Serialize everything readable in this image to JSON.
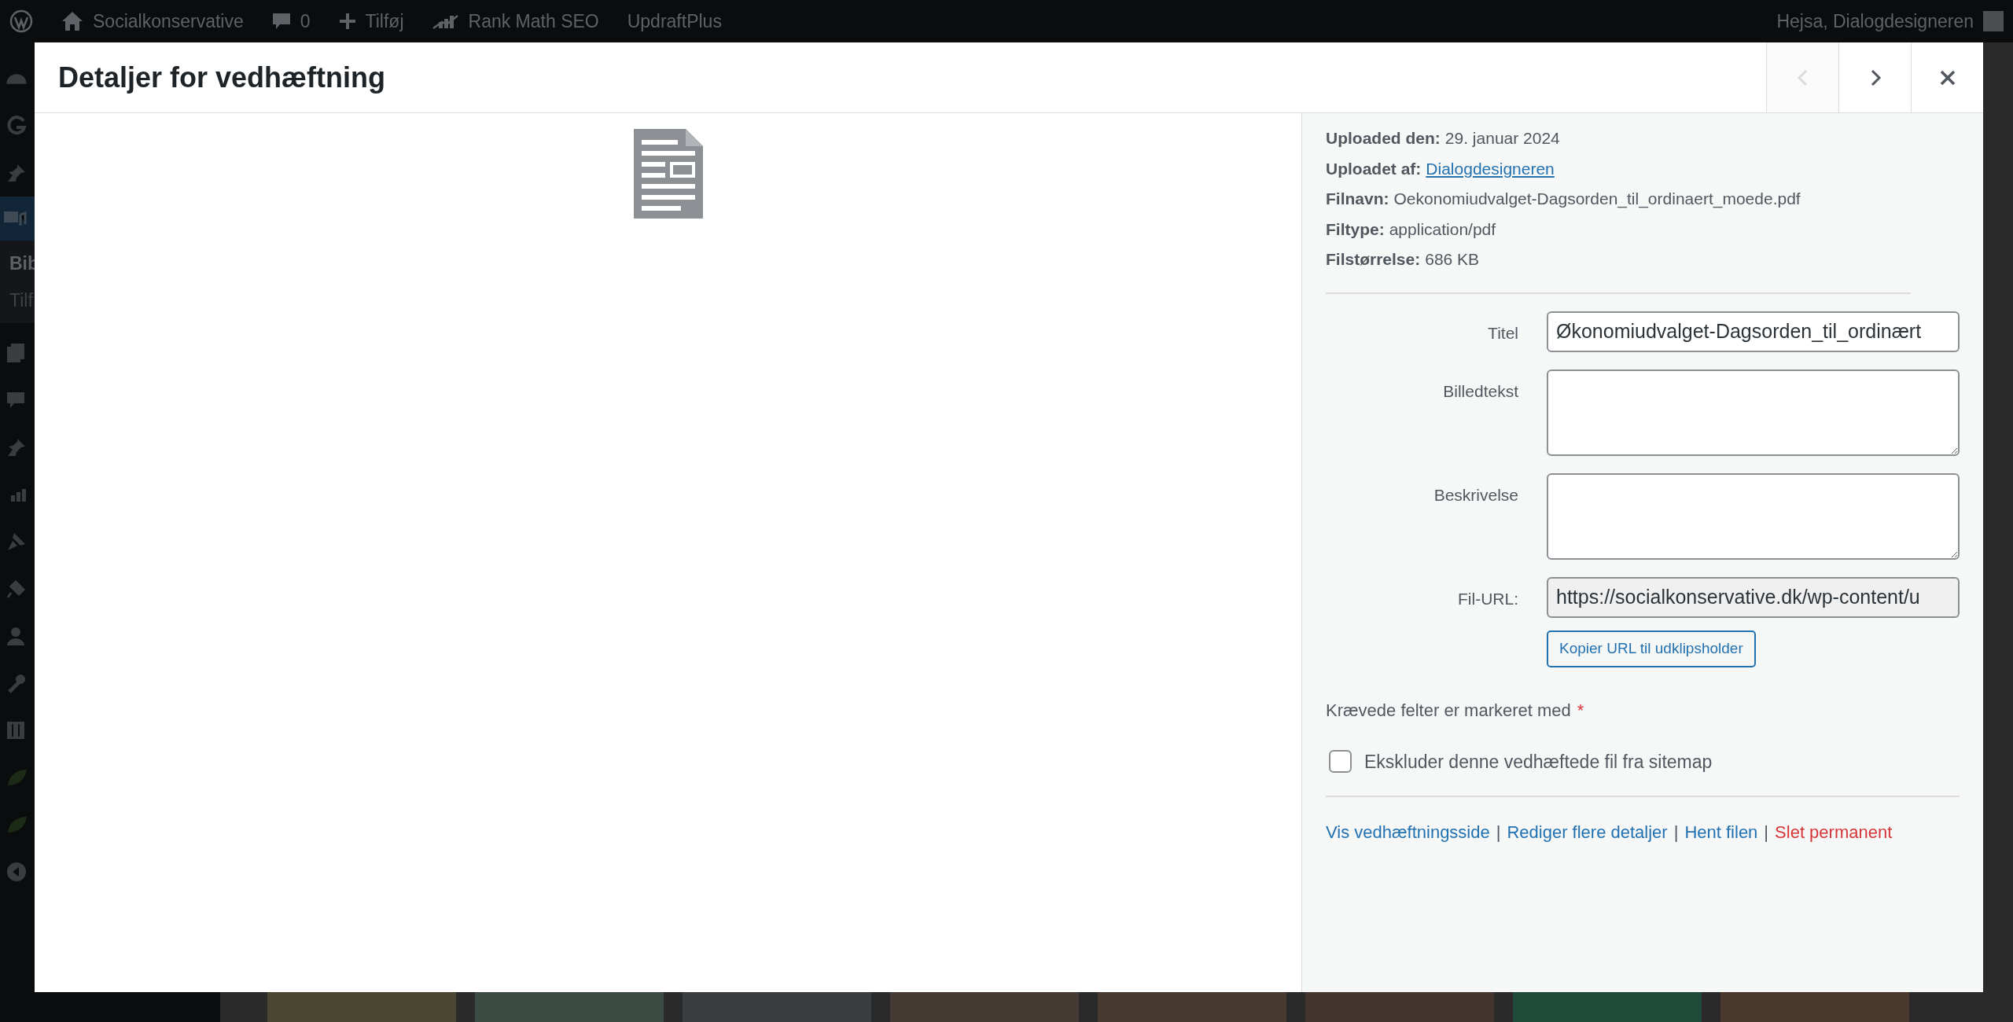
{
  "admin_bar": {
    "items": [
      {
        "kind": "logo"
      },
      {
        "kind": "home",
        "label": "Socialkonservative"
      },
      {
        "kind": "comments",
        "label": "0"
      },
      {
        "kind": "add",
        "label": "Tilføj"
      },
      {
        "kind": "rankmath",
        "label": "Rank Math SEO"
      },
      {
        "kind": "text",
        "label": "UpdraftPlus"
      }
    ],
    "greeting": "Hejsa, Dialogdesigneren"
  },
  "admin_menu": {
    "current_label": "Bib",
    "submenu_item": "Tilf"
  },
  "modal": {
    "title": "Detaljer for vedhæftning",
    "nav": [
      {
        "kind": "prev",
        "disabled": true
      },
      {
        "kind": "next",
        "disabled": false
      }
    ],
    "details": [
      {
        "label": "Uploaded den:",
        "value": "29. januar 2024",
        "link": false
      },
      {
        "label": "Uploadet af:",
        "value": "Dialogdesigneren",
        "link": true
      },
      {
        "label": "Filnavn:",
        "value": "Oekonomiudvalget-Dagsorden_til_ordinaert_moede.pdf",
        "link": false
      },
      {
        "label": "Filtype:",
        "value": "application/pdf",
        "link": false
      },
      {
        "label": "Filstørrelse:",
        "value": "686 KB",
        "link": false
      }
    ],
    "fields": [
      {
        "label": "Titel",
        "kind": "input",
        "value": "Økonomiudvalget-Dagsorden_til_ordinært"
      },
      {
        "label": "Billedtekst",
        "kind": "textarea"
      },
      {
        "label": "Beskrivelse",
        "kind": "textarea"
      },
      {
        "label": "Fil-URL:",
        "kind": "readonly",
        "value": "https://socialkonservative.dk/wp-content/u"
      }
    ],
    "copy_button": "Kopier URL til udklipsholder",
    "required_note": {
      "text": "Krævede felter er markeret med",
      "marker": "*"
    },
    "checkbox": {
      "label": "Ekskluder denne vedhæftede fil fra sitemap",
      "checked": false
    },
    "actions": [
      {
        "kind": "link",
        "label": "Vis vedhæftningsside"
      },
      {
        "kind": "separator",
        "label": "|"
      },
      {
        "kind": "link",
        "label": "Rediger flere detaljer"
      },
      {
        "kind": "separator",
        "label": "|"
      },
      {
        "kind": "link",
        "label": "Hent filen"
      },
      {
        "kind": "separator",
        "label": "|"
      },
      {
        "kind": "delete",
        "label": "Slet permanent"
      }
    ]
  }
}
